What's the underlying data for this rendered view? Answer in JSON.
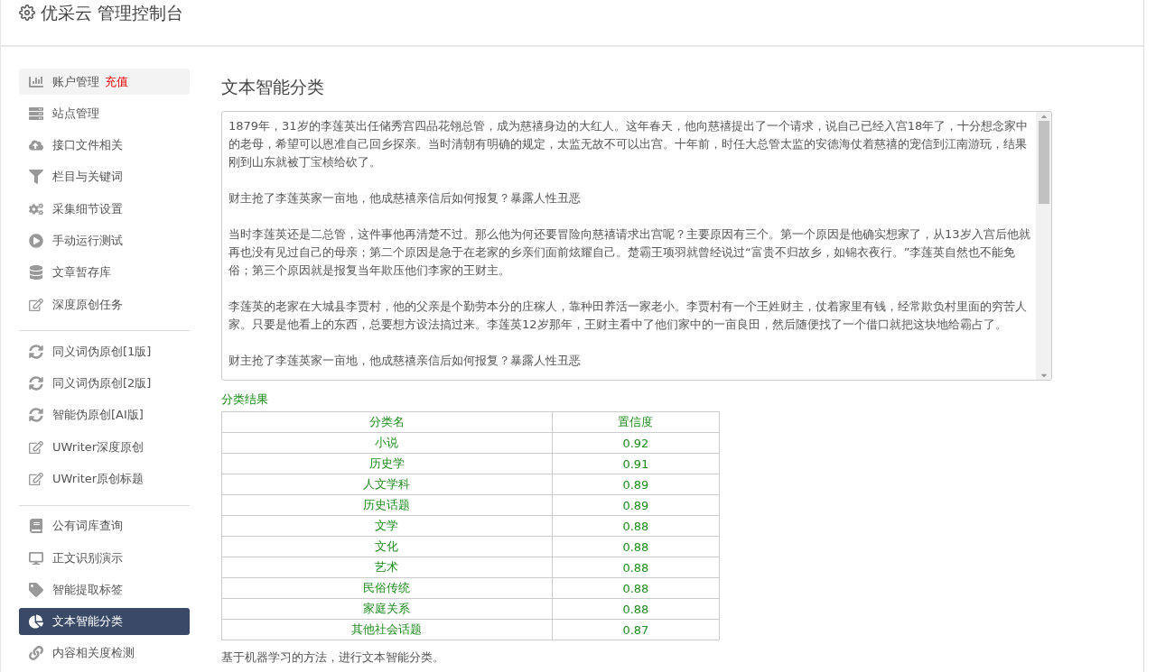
{
  "header": {
    "title": "优采云 管理控制台"
  },
  "sidebar": {
    "groups": [
      [
        {
          "label": "账户管理",
          "badge": "充值",
          "selected": false,
          "hovered": true
        },
        {
          "label": "站点管理",
          "selected": false,
          "hovered": false
        },
        {
          "label": "接口文件相关",
          "selected": false,
          "hovered": false
        },
        {
          "label": "栏目与关键词",
          "selected": false,
          "hovered": false
        },
        {
          "label": "采集细节设置",
          "selected": false,
          "hovered": false
        },
        {
          "label": "手动运行测试",
          "selected": false,
          "hovered": false
        },
        {
          "label": "文章暂存库",
          "selected": false,
          "hovered": false
        },
        {
          "label": "深度原创任务",
          "selected": false,
          "hovered": false
        }
      ],
      [
        {
          "label": "同义词伪原创[1版]",
          "selected": false,
          "hovered": false
        },
        {
          "label": "同义词伪原创[2版]",
          "selected": false,
          "hovered": false
        },
        {
          "label": "智能伪原创[AI版]",
          "selected": false,
          "hovered": false
        },
        {
          "label": "UWriter深度原创",
          "selected": false,
          "hovered": false
        },
        {
          "label": "UWriter原创标题",
          "selected": false,
          "hovered": false
        }
      ],
      [
        {
          "label": "公有词库查询",
          "selected": false,
          "hovered": false
        },
        {
          "label": "正文识别演示",
          "selected": false,
          "hovered": false
        },
        {
          "label": "智能提取标签",
          "selected": false,
          "hovered": false
        },
        {
          "label": "文本智能分类",
          "selected": true,
          "hovered": false
        },
        {
          "label": "内容相关度检测",
          "selected": false,
          "hovered": false
        }
      ]
    ]
  },
  "main": {
    "title": "文本智能分类",
    "text_paragraphs": [
      "1879年，31岁的李莲英出任储秀宫四品花翎总管，成为慈禧身边的大红人。这年春天，他向慈禧提出了一个请求，说自己已经入宫18年了，十分想念家中的老母，希望可以恩准自己回乡探亲。当时清朝有明确的规定，太监无故不可以出宫。十年前，时任大总管太监的安德海仗着慈禧的宠信到江南游玩，结果刚到山东就被丁宝桢给砍了。",
      "财主抢了李莲英家一亩地，他成慈禧亲信后如何报复？暴露人性丑恶",
      "当时李莲英还是二总管，这件事他再清楚不过。那么他为何还要冒险向慈禧请求出宫呢？主要原因有三个。第一个原因是他确实想家了，从13岁入宫后他就再也没有见过自己的母亲；第二个原因是急于在老家的乡亲们面前炫耀自己。楚霸王项羽就曾经说过“富贵不归故乡，如锦衣夜行。”李莲英自然也不能免俗；第三个原因就是报复当年欺压他们李家的王财主。",
      "李莲英的老家在大城县李贾村，他的父亲是个勤劳本分的庄稼人，靠种田养活一家老小。李贾村有一个王姓财主，仗着家里有钱，经常欺负村里面的穷苦人家。只要是他看上的东西，总要想方设法搞过来。李莲英12岁那年，王财主看中了他们家中的一亩良田，然后随便找了一个借口就把这块地给霸占了。",
      "财主抢了李莲英家一亩地，他成慈禧亲信后如何报复？暴露人性丑恶"
    ],
    "result_label": "分类结果",
    "table": {
      "columns": [
        "分类名",
        "置信度"
      ],
      "rows": [
        [
          "小说",
          "0.92"
        ],
        [
          "历史学",
          "0.91"
        ],
        [
          "人文学科",
          "0.89"
        ],
        [
          "历史话题",
          "0.89"
        ],
        [
          "文学",
          "0.88"
        ],
        [
          "文化",
          "0.88"
        ],
        [
          "艺术",
          "0.88"
        ],
        [
          "民俗传统",
          "0.88"
        ],
        [
          "家庭关系",
          "0.88"
        ],
        [
          "其他社会话题",
          "0.87"
        ]
      ]
    },
    "description": "基于机器学习的方法，进行文本智能分类。"
  }
}
